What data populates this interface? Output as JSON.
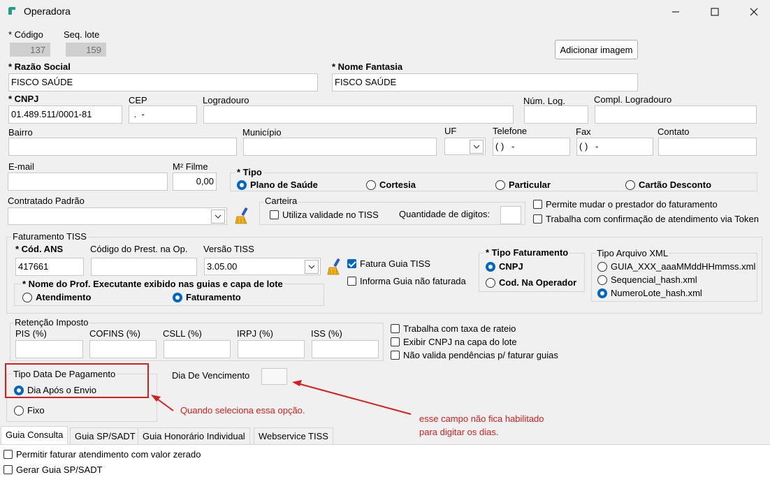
{
  "window": {
    "title": "Operadora",
    "minimize_icon": "minimize-icon",
    "maximize_icon": "maximize-icon",
    "close_icon": "close-icon"
  },
  "header": {
    "codigo_label": "* Código",
    "codigo_value": "137",
    "seq_lote_label": "Seq. lote",
    "seq_lote_value": "159",
    "add_image_button": "Adicionar imagem"
  },
  "identity": {
    "razao_social_label": "* Razão Social",
    "razao_social_value": "FISCO SAÚDE",
    "nome_fantasia_label": "* Nome Fantasia",
    "nome_fantasia_value": "FISCO SAÚDE"
  },
  "address": {
    "cnpj_label": "* CNPJ",
    "cnpj_value": "01.489.511/0001-81",
    "cep_label": "CEP",
    "cep_value": " .  -",
    "logradouro_label": "Logradouro",
    "logradouro_value": "",
    "num_log_label": "Núm. Log.",
    "num_log_value": "",
    "compl_label": "Compl. Logradouro",
    "compl_value": "",
    "bairro_label": "Bairro",
    "bairro_value": "",
    "municipio_label": "Município",
    "municipio_value": "",
    "uf_label": "UF",
    "uf_value": "",
    "telefone_label": "Telefone",
    "telefone_value": "( )   -",
    "fax_label": "Fax",
    "fax_value": "( )   -",
    "contato_label": "Contato",
    "contato_value": ""
  },
  "contact": {
    "email_label": "E-mail",
    "email_value": "",
    "m2_filme_label": "M² Filme",
    "m2_filme_value": "0,00"
  },
  "tipo": {
    "label": "* Tipo",
    "options": [
      "Plano de Saúde",
      "Cortesia",
      "Particular",
      "Cartão Desconto"
    ],
    "selected": "Plano de Saúde"
  },
  "contratado": {
    "label": "Contratado Padrão",
    "value": ""
  },
  "carteira": {
    "title": "Carteira",
    "utiliza_validade": "Utiliza validade no TISS",
    "qtd_digitos_label": "Quantidade de digitos:",
    "qtd_digitos_value": ""
  },
  "options_right": {
    "permite_mudar": "Permite mudar o prestador do faturamento",
    "trabalha_token": "Trabalha com confirmação de atendimento via Token"
  },
  "faturamento_tiss": {
    "title": "Faturamento TISS",
    "cod_ans_label": "* Cód. ANS",
    "cod_ans_value": "417661",
    "cod_prest_label": "Código do Prest. na Op.",
    "cod_prest_value": "",
    "versao_label": "Versão TISS",
    "versao_value": "3.05.00",
    "fatura_guia": "Fatura Guia TISS",
    "informa_guia": "Informa Guia não faturada",
    "nome_prof_title": "* Nome do Prof. Executante exibido nas guias e capa de lote",
    "nome_prof_options": [
      "Atendimento",
      "Faturamento"
    ],
    "tipo_fat_title": "* Tipo Faturamento",
    "tipo_fat_options": [
      "CNPJ",
      "Cod. Na Operador"
    ],
    "tipo_xml_title": "Tipo Arquivo XML",
    "tipo_xml_options": [
      "GUIA_XXX_aaaMMddHHmmss.xml",
      "Sequencial_hash.xml",
      "NumeroLote_hash.xml"
    ]
  },
  "retencao": {
    "title": "Retenção Imposto",
    "pis_label": "PIS (%)",
    "cofins_label": "COFINS (%)",
    "csll_label": "CSLL (%)",
    "irpj_label": "IRPJ (%)",
    "iss_label": "ISS (%)"
  },
  "options_mid": {
    "taxa_rateio": "Trabalha com taxa de rateio",
    "exibir_cnpj": "Exibir CNPJ na capa do lote",
    "nao_valida": "Não valida pendências p/ faturar guias"
  },
  "pagamento": {
    "title": "Tipo Data De Pagamento",
    "options": [
      "Dia Após o Envio",
      "Fixo"
    ],
    "dia_vencimento_label": "Dia De Vencimento",
    "dia_vencimento_value": ""
  },
  "annotations": {
    "note1": "Quando seleciona essa opção.",
    "note2_line1": "esse campo não fica habilitado",
    "note2_line2": "para digitar os dias.",
    "color": "#d42020"
  },
  "tabs": [
    "Guia Consulta",
    "Guia SP/SADT",
    "Guia Honorário Individual",
    "Webservice TISS"
  ],
  "tab_panel": {
    "permitir_zerado": "Permitir faturar atendimento com valor zerado",
    "gerar_sadt": "Gerar Guia SP/SADT"
  },
  "colors": {
    "accent": "#0067c0",
    "background": "#f0f0f0",
    "annotation_red": "#d42020"
  }
}
